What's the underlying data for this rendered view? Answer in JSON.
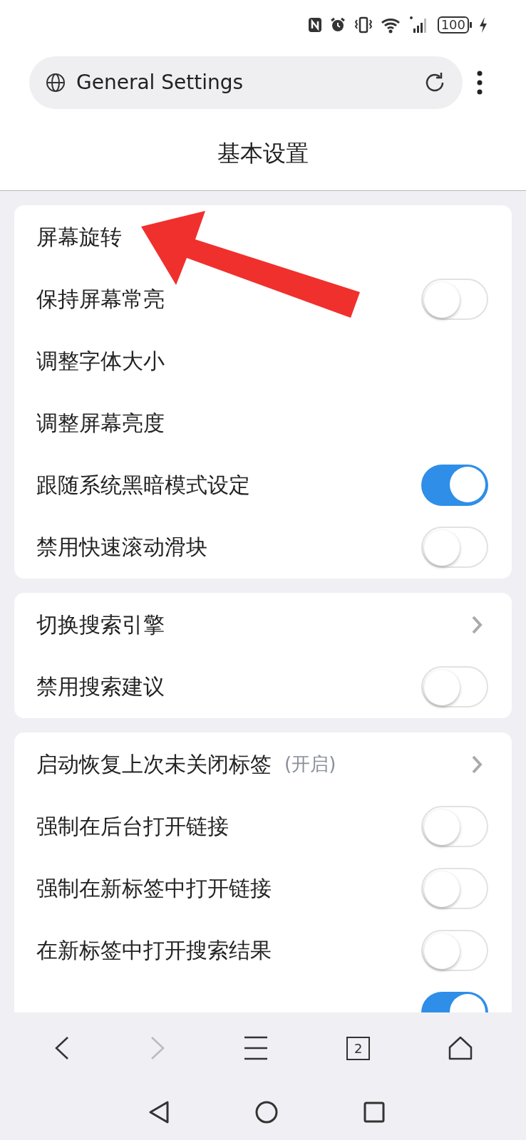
{
  "status_bar": {
    "battery": "100"
  },
  "address_bar": {
    "title": "General Settings"
  },
  "page_title": "基本设置",
  "groups": [
    {
      "rows": [
        {
          "kind": "plain",
          "label": "屏幕旋转"
        },
        {
          "kind": "toggle",
          "label": "保持屏幕常亮",
          "on": false
        },
        {
          "kind": "plain",
          "label": "调整字体大小"
        },
        {
          "kind": "plain",
          "label": "调整屏幕亮度"
        },
        {
          "kind": "toggle",
          "label": "跟随系统黑暗模式设定",
          "on": true
        },
        {
          "kind": "toggle",
          "label": "禁用快速滚动滑块",
          "on": false
        }
      ]
    },
    {
      "rows": [
        {
          "kind": "link",
          "label": "切换搜索引擎"
        },
        {
          "kind": "toggle",
          "label": "禁用搜索建议",
          "on": false
        }
      ]
    },
    {
      "rows": [
        {
          "kind": "link",
          "label": "启动恢复上次未关闭标签",
          "value": "(开启)"
        },
        {
          "kind": "toggle",
          "label": "强制在后台打开链接",
          "on": false
        },
        {
          "kind": "toggle",
          "label": "强制在新标签中打开链接",
          "on": false
        },
        {
          "kind": "toggle",
          "label": "在新标签中打开搜索结果",
          "on": false
        },
        {
          "kind": "toggle",
          "on": true
        }
      ]
    }
  ],
  "toolbar": {
    "tab_count": "2",
    "forward_disabled": true
  }
}
